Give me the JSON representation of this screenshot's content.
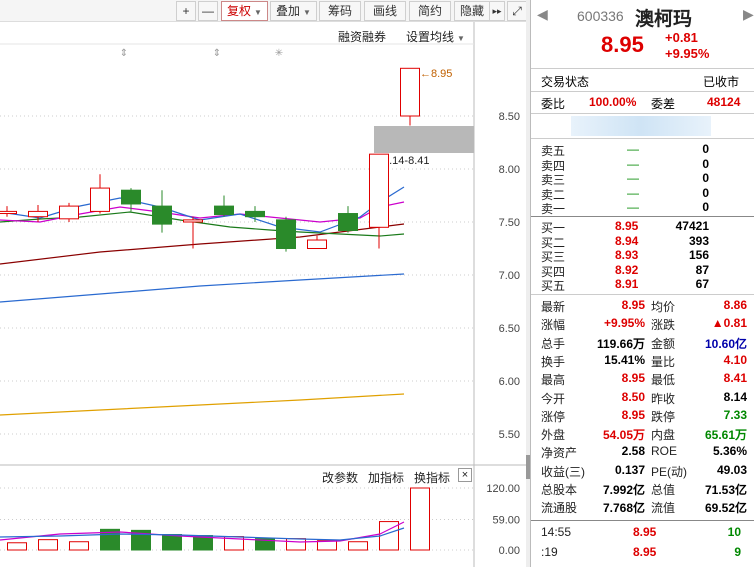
{
  "toolbar": {
    "plus": "+",
    "minus": "—",
    "fuquan": "复权",
    "diejia": "叠加",
    "chouma": "筹码",
    "huaxian": "画线",
    "jianyue": "简约",
    "yincang": "隐藏",
    "more": "▸▸",
    "expand": "⤢"
  },
  "chart": {
    "margin_trade": "融资融券",
    "set_ma": "设置均线",
    "high_label": "8.95",
    "range_label": "8.14-8.41",
    "price_ticks": [
      "8.50",
      "8.00",
      "7.50",
      "7.00",
      "6.50",
      "6.00",
      "5.50"
    ],
    "vol_ticks": [
      "120.00",
      "59.00",
      "0.00"
    ],
    "change_param": "改参数",
    "add_indicator": "加指标",
    "switch_indicator": "换指标",
    "close": "×"
  },
  "chart_data": {
    "type": "candlestick",
    "price_range": [
      5.5,
      8.95
    ],
    "candles": [
      {
        "open": 7.58,
        "close": 7.6,
        "high": 7.65,
        "low": 7.55,
        "up": true
      },
      {
        "open": 7.55,
        "close": 7.6,
        "high": 7.66,
        "low": 7.5,
        "up": true
      },
      {
        "open": 7.53,
        "close": 7.65,
        "high": 7.68,
        "low": 7.5,
        "up": true
      },
      {
        "open": 7.6,
        "close": 7.82,
        "high": 7.95,
        "low": 7.58,
        "up": true
      },
      {
        "open": 7.8,
        "close": 7.67,
        "high": 7.82,
        "low": 7.6,
        "up": false
      },
      {
        "open": 7.65,
        "close": 7.48,
        "high": 7.8,
        "low": 7.4,
        "up": false
      },
      {
        "open": 7.5,
        "close": 7.52,
        "high": 7.55,
        "low": 7.25,
        "up": true
      },
      {
        "open": 7.65,
        "close": 7.57,
        "high": 7.75,
        "low": 7.55,
        "up": false
      },
      {
        "open": 7.6,
        "close": 7.55,
        "high": 7.65,
        "low": 7.5,
        "up": false
      },
      {
        "open": 7.52,
        "close": 7.25,
        "high": 7.55,
        "low": 7.22,
        "up": false
      },
      {
        "open": 7.25,
        "close": 7.33,
        "high": 7.37,
        "low": 7.25,
        "up": true
      },
      {
        "open": 7.58,
        "close": 7.42,
        "high": 7.65,
        "low": 7.4,
        "up": false
      },
      {
        "open": 7.45,
        "close": 8.14,
        "high": 8.14,
        "low": 7.25,
        "up": true
      },
      {
        "open": 8.5,
        "close": 8.95,
        "high": 8.95,
        "low": 8.41,
        "up": true
      }
    ],
    "volume_range": [
      0,
      120
    ],
    "volumes": [
      18,
      14,
      20,
      16,
      40,
      38,
      30,
      28,
      26,
      22,
      22,
      18,
      16,
      55,
      120
    ],
    "volume_up": [
      false,
      true,
      true,
      true,
      false,
      false,
      false,
      false,
      true,
      false,
      true,
      true,
      true,
      true,
      true
    ]
  },
  "quote": {
    "code": "600336",
    "name": "澳柯玛",
    "price": "8.95",
    "change": "+0.81",
    "change_pct": "+9.95%",
    "trade_status_label": "交易状态",
    "trade_status": "已收市",
    "weibi_label": "委比",
    "weibi": "100.00%",
    "weicha_label": "委差",
    "weicha": "48124",
    "sell": [
      {
        "label": "卖五",
        "price": "—",
        "vol": "0"
      },
      {
        "label": "卖四",
        "price": "—",
        "vol": "0"
      },
      {
        "label": "卖三",
        "price": "—",
        "vol": "0"
      },
      {
        "label": "卖二",
        "price": "—",
        "vol": "0"
      },
      {
        "label": "卖一",
        "price": "—",
        "vol": "0"
      }
    ],
    "buy": [
      {
        "label": "买一",
        "price": "8.95",
        "vol": "47421"
      },
      {
        "label": "买二",
        "price": "8.94",
        "vol": "393"
      },
      {
        "label": "买三",
        "price": "8.93",
        "vol": "156"
      },
      {
        "label": "买四",
        "price": "8.92",
        "vol": "87"
      },
      {
        "label": "买五",
        "price": "8.91",
        "vol": "67"
      }
    ],
    "stats": [
      {
        "l1": "最新",
        "v1": "8.95",
        "c1": "red",
        "l2": "均价",
        "v2": "8.86",
        "c2": "red"
      },
      {
        "l1": "涨幅",
        "v1": "+9.95%",
        "c1": "red",
        "l2": "涨跌",
        "v2": "▲0.81",
        "c2": "red"
      },
      {
        "l1": "总手",
        "v1": "119.66万",
        "c1": "",
        "l2": "金额",
        "v2": "10.60亿",
        "c2": "blue"
      },
      {
        "l1": "换手",
        "v1": "15.41%",
        "c1": "",
        "l2": "量比",
        "v2": "4.10",
        "c2": "red"
      },
      {
        "l1": "最高",
        "v1": "8.95",
        "c1": "red",
        "l2": "最低",
        "v2": "8.41",
        "c2": "red"
      },
      {
        "l1": "今开",
        "v1": "8.50",
        "c1": "red",
        "l2": "昨收",
        "v2": "8.14",
        "c2": ""
      },
      {
        "l1": "涨停",
        "v1": "8.95",
        "c1": "red",
        "l2": "跌停",
        "v2": "7.33",
        "c2": "green"
      },
      {
        "l1": "外盘",
        "v1": "54.05万",
        "c1": "red",
        "l2": "内盘",
        "v2": "65.61万",
        "c2": "green"
      },
      {
        "l1": "净资产",
        "v1": "2.58",
        "c1": "",
        "l2": "ROE",
        "v2": "5.36%",
        "c2": ""
      },
      {
        "l1": "收益(三)",
        "v1": "0.137",
        "c1": "",
        "l2": "PE(动)",
        "v2": "49.03",
        "c2": ""
      },
      {
        "l1": "总股本",
        "v1": "7.992亿",
        "c1": "",
        "l2": "总值",
        "v2": "71.53亿",
        "c2": ""
      },
      {
        "l1": "流通股",
        "v1": "7.768亿",
        "c1": "",
        "l2": "流值",
        "v2": "69.52亿",
        "c2": ""
      }
    ],
    "ticks": [
      {
        "time": "14:55",
        "price": "8.95",
        "vol": "10"
      },
      {
        "time": ":19",
        "price": "8.95",
        "vol": "9"
      }
    ]
  },
  "colors": {
    "up": "#e00000",
    "down": "#2a8a2a",
    "ma5": "#444",
    "ma10": "#cc00cc",
    "ma20": "#1a7a1a",
    "ma30": "#8a0000",
    "ma60": "#2a6ad0",
    "ma120": "#e0a000"
  }
}
